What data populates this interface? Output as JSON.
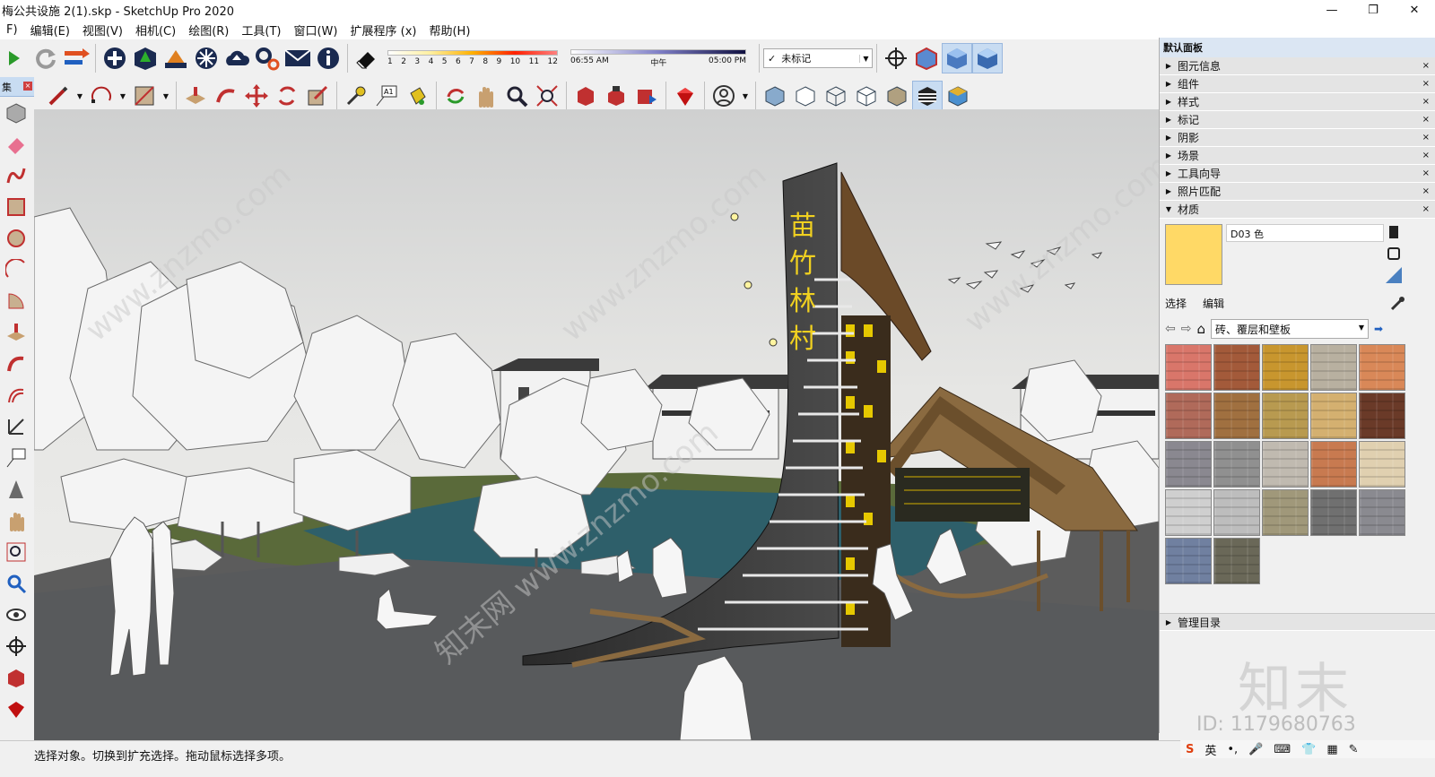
{
  "window": {
    "title": "梅公共设施 2(1).skp - SketchUp Pro 2020",
    "controls": [
      "—",
      "❐",
      "✕"
    ]
  },
  "menu": [
    "F)",
    "编辑(E)",
    "视图(V)",
    "相机(C)",
    "绘图(R)",
    "工具(T)",
    "窗口(W)",
    "扩展程序 (x)",
    "帮助(H)"
  ],
  "shadow_months": [
    "1",
    "2",
    "3",
    "4",
    "5",
    "6",
    "7",
    "8",
    "9",
    "10",
    "11",
    "12"
  ],
  "shadow_times": {
    "start": "06:55 AM",
    "mid": "中午",
    "end": "05:00 PM"
  },
  "tag_selector": {
    "check": "✓",
    "value": "未标记"
  },
  "left_toolbar": {
    "title": "集"
  },
  "scene": {
    "sign_text": "苗竹林村",
    "watermark": "www.znzmo.com",
    "watermark_cn": "知末网"
  },
  "tray": {
    "title": "默认面板",
    "panels": [
      "图元信息",
      "组件",
      "样式",
      "标记",
      "阴影",
      "场景",
      "工具向导",
      "照片匹配"
    ],
    "materials": {
      "title": "材质",
      "name": "D03 色",
      "swatch_color": "#ffd966",
      "tabs": [
        "选择",
        "编辑"
      ],
      "library": "砖、覆层和壁板",
      "textures": [
        "#d9766a",
        "#a35a3a",
        "#c8962e",
        "#b8b0a0",
        "#d98858",
        "#b06a5a",
        "#a07040",
        "#b89a50",
        "#d4b070",
        "#6a3a28",
        "#8a8890",
        "#909090",
        "#c0bab0",
        "#c87a50",
        "#e0d0b0",
        "#cfcfcf",
        "#bdbdbd",
        "#a0987a",
        "#707070",
        "#8a8a90",
        "#7080a0",
        "#6a6858"
      ]
    },
    "manager": "管理目录"
  },
  "status": {
    "message": "选择对象。切换到扩充选择。拖动鼠标选择多项。"
  },
  "ime": [
    "S",
    "英",
    "•,",
    "🎤",
    "⌨",
    "👕",
    "▦",
    "✎"
  ],
  "brand_watermark": {
    "logo": "知末",
    "id": "ID: 1179680763"
  }
}
